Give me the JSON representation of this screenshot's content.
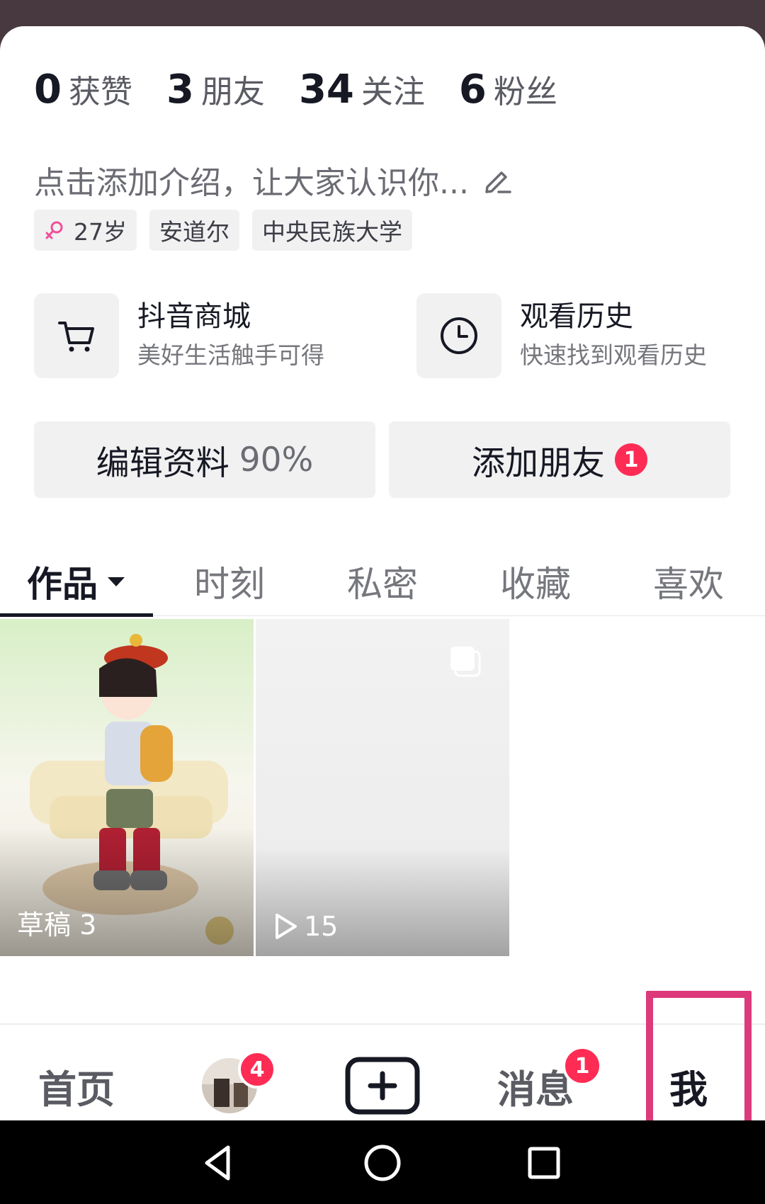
{
  "stats": [
    {
      "num": "0",
      "label": "获赞"
    },
    {
      "num": "3",
      "label": "朋友"
    },
    {
      "num": "34",
      "label": "关注"
    },
    {
      "num": "6",
      "label": "粉丝"
    }
  ],
  "bio": {
    "placeholder": "点击添加介绍，让大家认识你..."
  },
  "tags": {
    "age": "27岁",
    "location": "安道尔",
    "school": "中央民族大学"
  },
  "shortcuts": [
    {
      "title": "抖音商城",
      "subtitle": "美好生活触手可得",
      "icon": "cart-icon"
    },
    {
      "title": "观看历史",
      "subtitle": "快速找到观看历史",
      "icon": "clock-icon"
    }
  ],
  "actions": {
    "edit_label": "编辑资料",
    "edit_progress": "90%",
    "add_friend_label": "添加朋友",
    "add_friend_badge": "1"
  },
  "tabs": [
    "作品",
    "时刻",
    "私密",
    "收藏",
    "喜欢"
  ],
  "grid": [
    {
      "label": "草稿 3"
    },
    {
      "play_count": "15"
    }
  ],
  "nav": {
    "home": "首页",
    "friends_badge": "4",
    "messages": "消息",
    "messages_badge": "1",
    "me": "我"
  },
  "colors": {
    "accent": "#fe2c55",
    "highlight": "#dc3a7a"
  }
}
